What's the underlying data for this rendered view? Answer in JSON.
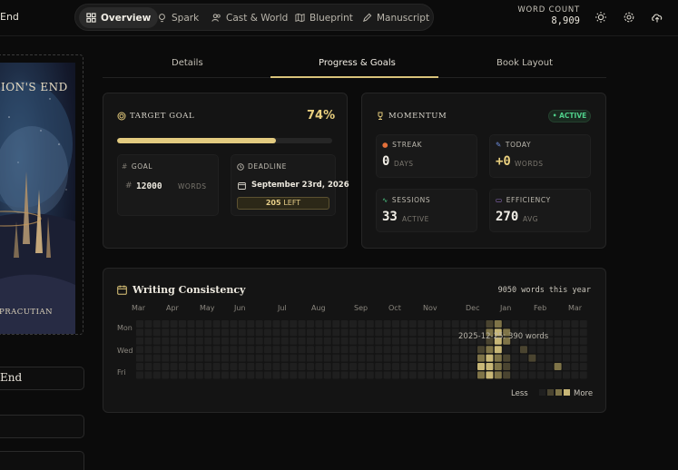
{
  "app": {
    "title_fragment": "End"
  },
  "nav": [
    {
      "label": "Overview",
      "icon": "grid-icon",
      "active": true
    },
    {
      "label": "Spark",
      "icon": "lightbulb-icon"
    },
    {
      "label": "Cast & World",
      "icon": "users-icon"
    },
    {
      "label": "Blueprint",
      "icon": "map-icon"
    },
    {
      "label": "Manuscript",
      "icon": "pen-icon"
    }
  ],
  "word_count": {
    "label": "WORD COUNT",
    "value": "8,909"
  },
  "book": {
    "cover_title": "ION'S END",
    "cover_author": "PRACUTIAN",
    "title_field": "End"
  },
  "tabs": [
    {
      "label": "Details"
    },
    {
      "label": "Progress & Goals",
      "active": true
    },
    {
      "label": "Book Layout"
    }
  ],
  "target_goal": {
    "title": "TARGET GOAL",
    "percent_label": "74%",
    "progress": 0.74,
    "goal_label": "GOAL",
    "goal_value": "12000",
    "goal_unit": "WORDS",
    "deadline_label": "DEADLINE",
    "deadline_value": "September 23rd, 2026",
    "days_left": "205",
    "left_label": "LEFT"
  },
  "momentum": {
    "title": "MOMENTUM",
    "status": "ACTIVE",
    "streak": {
      "label": "STREAK",
      "value": "0",
      "unit": "DAYS"
    },
    "today": {
      "label": "TODAY",
      "value": "+0",
      "unit": "WORDS"
    },
    "sessions": {
      "label": "SESSIONS",
      "value": "33",
      "unit": "ACTIVE"
    },
    "efficiency": {
      "label": "EFFICIENCY",
      "value": "270",
      "unit": "AVG"
    }
  },
  "consistency": {
    "title": "Writing Consistency",
    "total": "9050 words this year",
    "months": [
      "Mar",
      "Apr",
      "May",
      "Jun",
      "Jul",
      "Aug",
      "Sep",
      "Oct",
      "Nov",
      "Dec",
      "Jan",
      "Feb",
      "Mar"
    ],
    "days": [
      "Mon",
      "Wed",
      "Fri"
    ],
    "tooltip": "2025-12-25: 390 words",
    "legend_less": "Less",
    "legend_more": "More",
    "colors": {
      "empty": "#1f1f1f",
      "low": "#4a4430",
      "mid": "#7f7448",
      "high": "#c8b777"
    }
  }
}
